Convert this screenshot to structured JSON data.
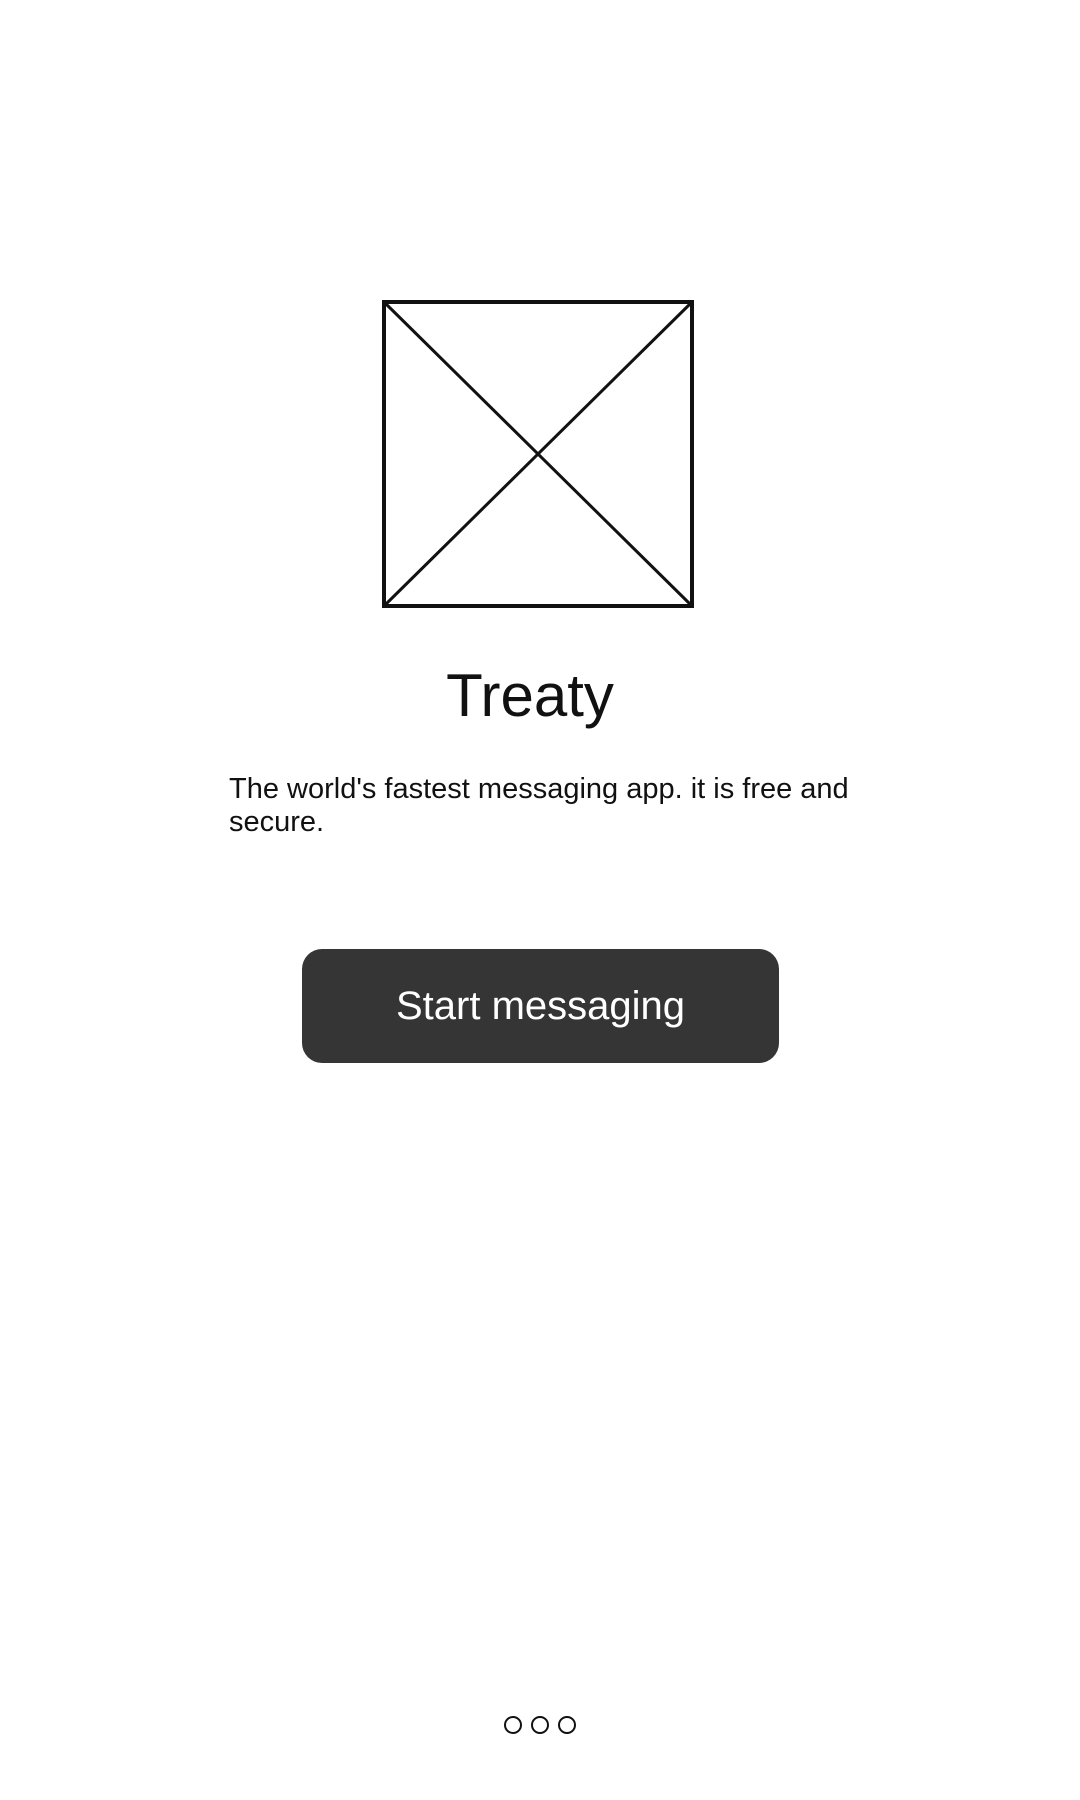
{
  "onboarding": {
    "logo_icon": "image-placeholder-icon",
    "title": "Treaty",
    "description": "The world's fastest messaging app. it is free and secure.",
    "cta_label": "Start messaging",
    "pager": {
      "total_pages": 3,
      "dots": [
        "page-indicator-dot",
        "page-indicator-dot",
        "page-indicator-dot"
      ]
    }
  },
  "colors": {
    "background": "#ffffff",
    "text": "#111111",
    "button_background": "#353535",
    "button_text": "#ffffff"
  }
}
